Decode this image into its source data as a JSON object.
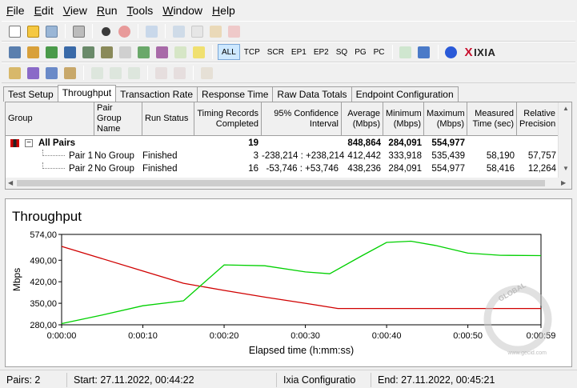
{
  "menu": [
    {
      "label": "File",
      "u": "F",
      "rest": "ile"
    },
    {
      "label": "Edit",
      "u": "E",
      "rest": "dit"
    },
    {
      "label": "View",
      "u": "V",
      "rest": "iew"
    },
    {
      "label": "Run",
      "u": "R",
      "rest": "un"
    },
    {
      "label": "Tools",
      "u": "T",
      "rest": "ools"
    },
    {
      "label": "Window",
      "u": "W",
      "rest": "indow"
    },
    {
      "label": "Help",
      "u": "H",
      "rest": "elp"
    }
  ],
  "toolbar2_filters": [
    "ALL",
    "TCP",
    "SCR",
    "EP1",
    "EP2",
    "SQ",
    "PG",
    "PC"
  ],
  "brand": {
    "x": "X",
    "rest": "IXIA"
  },
  "tabs": [
    "Test Setup",
    "Throughput",
    "Transaction Rate",
    "Response Time",
    "Raw Data Totals",
    "Endpoint Configuration"
  ],
  "active_tab": "Throughput",
  "grid": {
    "headers": {
      "group": "Group",
      "pair_group_name": [
        "Pair Group",
        "Name"
      ],
      "run_status": "Run Status",
      "timing_records": [
        "Timing Records",
        "Completed"
      ],
      "confidence": [
        "95% Confidence",
        "Interval"
      ],
      "average": [
        "Average",
        "(Mbps)"
      ],
      "minimum": [
        "Minimum",
        "(Mbps)"
      ],
      "maximum": [
        "Maximum",
        "(Mbps)"
      ],
      "measured_time": [
        "Measured",
        "Time (sec)"
      ],
      "relative_precision": [
        "Relative",
        "Precision"
      ]
    },
    "all_pairs": {
      "label": "All Pairs",
      "expander": "−",
      "records": "19",
      "average": "848,864",
      "minimum": "284,091",
      "maximum": "554,977"
    },
    "rows": [
      {
        "group": "Pair 1",
        "name": "No Group",
        "status": "Finished",
        "records": "3",
        "ci": "-238,214 : +238,214",
        "average": "412,442",
        "minimum": "333,918",
        "maximum": "535,439",
        "time": "58,190",
        "precision": "57,757"
      },
      {
        "group": "Pair 2",
        "name": "No Group",
        "status": "Finished",
        "records": "16",
        "ci": "-53,746 : +53,746",
        "average": "438,236",
        "minimum": "284,091",
        "maximum": "554,977",
        "time": "58,416",
        "precision": "12,264"
      }
    ]
  },
  "chart_data": {
    "type": "line",
    "title": "Throughput",
    "xlabel": "Elapsed time (h:mm:ss)",
    "ylabel": "Mbps",
    "x_ticks": [
      "0:00:00",
      "0:00:10",
      "0:00:20",
      "0:00:30",
      "0:00:40",
      "0:00:50",
      "0:00:59"
    ],
    "x_tick_seconds": [
      0,
      10,
      20,
      30,
      40,
      50,
      59
    ],
    "y_ticks": [
      "280,00",
      "350,00",
      "420,00",
      "490,00",
      "574,00"
    ],
    "y_tick_values": [
      280,
      350,
      420,
      490,
      574
    ],
    "xlim": [
      0,
      59
    ],
    "ylim": [
      280,
      574
    ],
    "grid": false,
    "series": [
      {
        "color": "#d00000",
        "x": [
          0,
          10,
          15,
          20,
          25,
          30,
          34,
          40,
          45,
          50,
          54,
          59
        ],
        "y": [
          535,
          455,
          415,
          392,
          370,
          350,
          333,
          333,
          333,
          333,
          333,
          333
        ]
      },
      {
        "color": "#00d000",
        "x": [
          0,
          5,
          10,
          15,
          20,
          25,
          30,
          33,
          37,
          40,
          43,
          46,
          50,
          54,
          59
        ],
        "y": [
          284,
          312,
          342,
          358,
          475,
          472,
          452,
          446,
          505,
          548,
          552,
          538,
          513,
          506,
          505
        ]
      }
    ]
  },
  "status": {
    "pairs": "Pairs: 2",
    "start": "Start: 27.11.2022, 00:44:22",
    "config": "Ixia Configuratio",
    "end": "End: 27.11.2022, 00:45:21"
  },
  "watermark": {
    "text": "GLOBAL",
    "url": "www.gecid.com"
  },
  "colors": {
    "accent_active": "#cde8ff",
    "series_pair1": "#d00000",
    "series_pair2": "#00d000"
  }
}
